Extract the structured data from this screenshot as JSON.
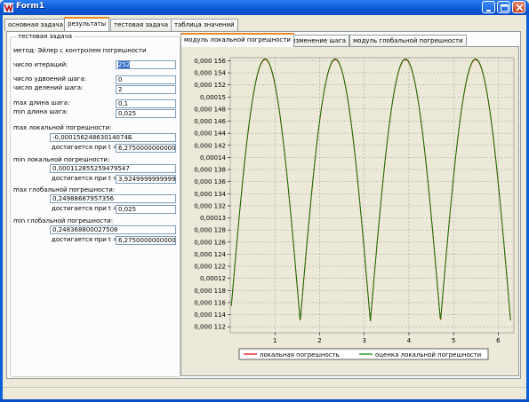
{
  "window": {
    "title": "Form1"
  },
  "tabs": [
    {
      "label": "основная задача"
    },
    {
      "label": "результаты"
    },
    {
      "label": "тестовая задача"
    },
    {
      "label": "таблица значений"
    }
  ],
  "group": {
    "title": "тестовая задача",
    "method": "метод:  Эйлер с контролем погрешности",
    "iterations_label": "число итераций:",
    "iterations_value": "252",
    "doublings_label": "число удвоений шага:",
    "doublings_value": "0",
    "divisions_label": "число делений шага:",
    "divisions_value": "2",
    "max_step_label": "max длина шага:",
    "max_step_value": "0,1",
    "min_step_label": "min длина шага:",
    "min_step_value": "0,025",
    "max_local_label": "max локальной погрешности:",
    "max_local_value": "-0,00015624863014074Б",
    "max_local_at_label": "достигается при t =",
    "max_local_at_value": "6,27500000000002",
    "min_local_label": "min локальной погрешности:",
    "min_local_value": "0,000112855259479547",
    "min_local_at_label": "достигается при t =",
    "min_local_at_value": "3,92499999999999",
    "max_global_label": "max глобальной погрешности:",
    "max_global_value": "0,24988687957356",
    "max_global_at_label": "достигается при t =",
    "max_global_at_value": "0,025",
    "min_global_label": "min глобальной погрешности:",
    "min_global_value": "0,248368800027508",
    "min_global_at_label": "достигается при t =",
    "min_global_at_value": "6,27500000000002"
  },
  "chart_tabs": [
    {
      "label": "модуль локальной погрешности"
    },
    {
      "label": "изменение шага"
    },
    {
      "label": "модуль глобальной погрешности"
    }
  ],
  "colors": {
    "series_local": "#e00000",
    "series_estimate": "#008000",
    "grid": "#9a9a9a",
    "plot_bg": "#ece9d8"
  },
  "chart_data": {
    "type": "line",
    "xlim": [
      0,
      6.35
    ],
    "ylim": [
      0.000111,
      0.0001565
    ],
    "x_ticks": [
      "1",
      "2",
      "3",
      "4",
      "5",
      "6"
    ],
    "x_tick_values": [
      1,
      2,
      3,
      4,
      5,
      6
    ],
    "y_tick_labels": [
      "0,000 156",
      "0,000 154",
      "0,000 152",
      "0,00015",
      "0,000 148",
      "0,000 146",
      "0,000 144",
      "0,000 142",
      "0,00014",
      "0,000 138",
      "0,000 136",
      "0,000 134",
      "0,000 132",
      "0,00013",
      "0,000 128",
      "0,000 126",
      "0,000 124",
      "0,000 122",
      "0,00012",
      "0,000 118",
      "0,000 116",
      "0,000 114",
      "0,000 112"
    ],
    "y_tick_values": [
      0.000156,
      0.000154,
      0.000152,
      0.00015,
      0.000148,
      0.000146,
      0.000144,
      0.000142,
      0.00014,
      0.000138,
      0.000136,
      0.000134,
      0.000132,
      0.00013,
      0.000128,
      0.000126,
      0.000124,
      0.000122,
      0.00012,
      0.000118,
      0.000116,
      0.000114,
      0.000112
    ],
    "min_value": 0.0001128,
    "max_value": 0.0001562,
    "x_range_start": 0.025,
    "x_range_end": 6.275,
    "grid": true,
    "legend_position": "bottom",
    "series": [
      {
        "name": "локальная погрешность"
      },
      {
        "name": "оценка локальной погрешности"
      }
    ]
  }
}
